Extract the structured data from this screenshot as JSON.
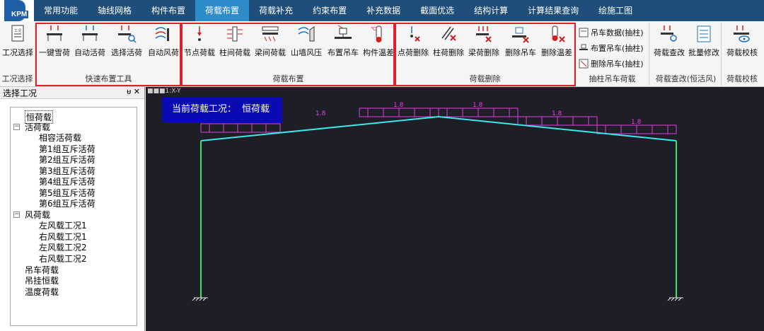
{
  "logo": {
    "text": "KPM"
  },
  "menu": {
    "tabs": [
      "常用功能",
      "轴线网格",
      "构件布置",
      "荷载布置",
      "荷载补充",
      "约束布置",
      "补充数据",
      "截面优选",
      "结构计算",
      "计算结果查询",
      "绘施工图"
    ],
    "active_index": 3
  },
  "ribbon": {
    "groups": {
      "case_select": {
        "label": "工况选择",
        "button": "工况选择"
      },
      "quick_tools": {
        "label": "快速布置工具",
        "buttons": [
          "一键雪荷",
          "自动活荷",
          "选择活荷",
          "自动风荷"
        ]
      },
      "load_layout": {
        "label": "荷载布置",
        "buttons": [
          "节点荷载",
          "柱间荷载",
          "梁间荷载",
          "山墙风压",
          "布置吊车",
          "构件温差"
        ]
      },
      "load_delete": {
        "label": "荷载删除",
        "buttons": [
          "点荷删除",
          "柱荷删除",
          "梁荷删除",
          "删除吊车",
          "删除温差"
        ]
      },
      "crane_column": {
        "label": "抽柱吊车荷载",
        "buttons": [
          "吊车数据(抽柱)",
          "布置吊车(抽柱)",
          "删除吊车(抽柱)"
        ]
      },
      "load_check_mod": {
        "label": "荷载查改(恒活风)",
        "buttons": [
          "荷载查改",
          "批量修改"
        ]
      },
      "load_verify": {
        "label": "荷载校核",
        "buttons": [
          "荷载校核"
        ]
      }
    }
  },
  "panel": {
    "title": "选择工况",
    "controls": "ᵾ ✕",
    "tree": {
      "dead": "恒荷载",
      "live": "活荷载",
      "live_children": [
        "相容活荷载",
        "第1组互斥活荷",
        "第2组互斥活荷",
        "第3组互斥活荷",
        "第4组互斥活荷",
        "第5组互斥活荷",
        "第6组互斥活荷"
      ],
      "wind": "风荷载",
      "wind_children": [
        "左风载工况1",
        "右风载工况1",
        "左风载工况2",
        "右风载工况2"
      ],
      "crane": "吊车荷载",
      "hanging": "吊挂恒载",
      "temperature": "温度荷载"
    }
  },
  "canvas": {
    "view_label": "■■■1:X-Y",
    "banner_label": "当前荷载工况：",
    "banner_value": "恒荷载",
    "load_value_labels": [
      "1.8",
      "1.8",
      "1.8",
      "1.8",
      "1.8"
    ]
  },
  "colors": {
    "menubar": "#1e4e79",
    "active_tab": "#2e8cc8",
    "highlight_box": "#e0202a",
    "rafter": "#3ee8e8",
    "column": "#2ee86e",
    "load": "#e040e0",
    "banner": "#0a0ab4"
  }
}
